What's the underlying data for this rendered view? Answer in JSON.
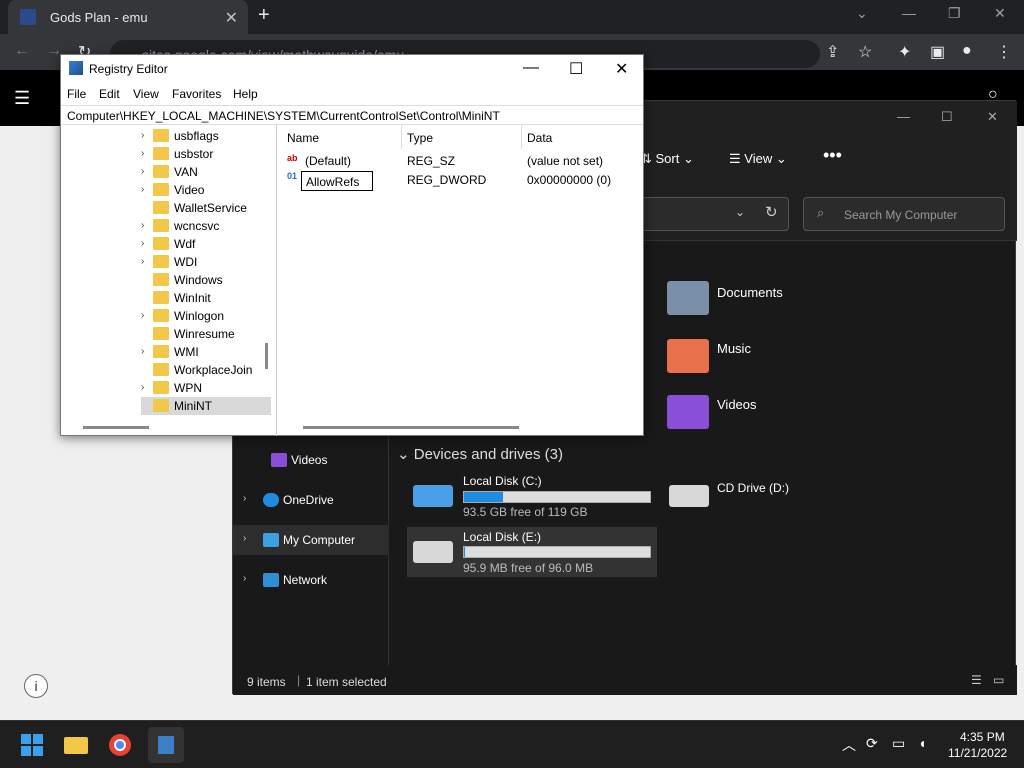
{
  "chrome": {
    "tab_title": "Gods Plan - emu",
    "url": "sites.google.com/view/mathwayguide/emu"
  },
  "explorer": {
    "sort_label": "Sort",
    "view_label": "View",
    "search_placeholder": "Search My Computer",
    "quick_access": [
      {
        "label": "Documents"
      },
      {
        "label": "Music"
      },
      {
        "label": "Videos"
      }
    ],
    "nav_items": [
      {
        "label": "Videos"
      },
      {
        "label": "OneDrive"
      },
      {
        "label": "My Computer"
      },
      {
        "label": "Network"
      }
    ],
    "devices_heading": "Devices and drives (3)",
    "drives": [
      {
        "label": "Local Disk (C:)",
        "free": "93.5 GB free of 119 GB",
        "used_fraction": 0.21
      },
      {
        "label": "CD Drive (D:)"
      },
      {
        "label": "Local Disk (E:)",
        "free": "95.9 MB free of 96.0 MB",
        "used_fraction": 0.001
      }
    ],
    "status_items": "9 items",
    "status_selected": "1 item selected"
  },
  "regedit": {
    "title": "Registry Editor",
    "menu": [
      "File",
      "Edit",
      "View",
      "Favorites",
      "Help"
    ],
    "path": "Computer\\HKEY_LOCAL_MACHINE\\SYSTEM\\CurrentControlSet\\Control\\MiniNT",
    "tree": [
      {
        "label": "usbflags",
        "expandable": true
      },
      {
        "label": "usbstor",
        "expandable": true
      },
      {
        "label": "VAN",
        "expandable": true
      },
      {
        "label": "Video",
        "expandable": true
      },
      {
        "label": "WalletService",
        "expandable": false
      },
      {
        "label": "wcncsvc",
        "expandable": true
      },
      {
        "label": "Wdf",
        "expandable": true
      },
      {
        "label": "WDI",
        "expandable": true
      },
      {
        "label": "Windows",
        "expandable": false
      },
      {
        "label": "WinInit",
        "expandable": false
      },
      {
        "label": "Winlogon",
        "expandable": true
      },
      {
        "label": "Winresume",
        "expandable": false
      },
      {
        "label": "WMI",
        "expandable": true
      },
      {
        "label": "WorkplaceJoin",
        "expandable": false
      },
      {
        "label": "WPN",
        "expandable": true
      },
      {
        "label": "MiniNT",
        "expandable": false
      }
    ],
    "columns": [
      "Name",
      "Type",
      "Data"
    ],
    "values": [
      {
        "name": "(Default)",
        "type": "REG_SZ",
        "data": "(value not set)"
      },
      {
        "name": "AllowRefs",
        "type": "REG_DWORD",
        "data": "0x00000000 (0)"
      }
    ]
  },
  "taskbar": {
    "time": "4:35 PM",
    "date": "11/21/2022"
  }
}
